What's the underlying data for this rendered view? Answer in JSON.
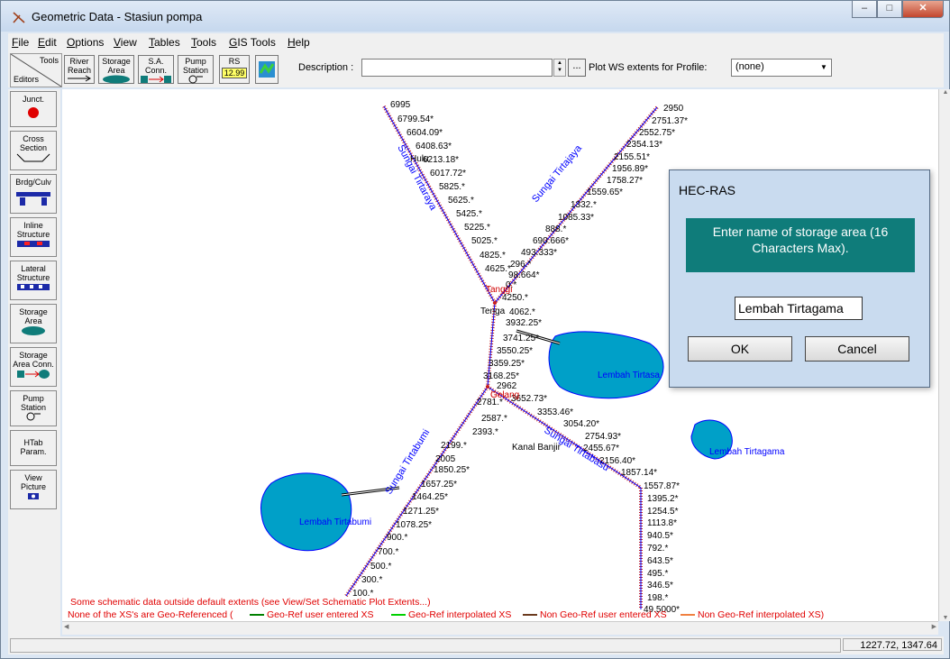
{
  "window": {
    "title": "Geometric Data - Stasiun pompa"
  },
  "menu": [
    {
      "u": "F",
      "rest": "ile"
    },
    {
      "u": "E",
      "rest": "dit"
    },
    {
      "u": "O",
      "rest": "ptions"
    },
    {
      "u": "V",
      "rest": "iew"
    },
    {
      "u": "T",
      "rest": "ables"
    },
    {
      "u": "T",
      "rest": "ools"
    },
    {
      "u": "G",
      "rest": "IS Tools"
    },
    {
      "u": "H",
      "rest": "elp"
    }
  ],
  "toolbar": {
    "corner_tools": "Tools",
    "corner_editors": "Editors",
    "river_reach": "River\nReach",
    "storage_area": "Storage\nArea",
    "sa_conn": "S.A.\nConn.",
    "pump_station": "Pump\nStation",
    "rs_label": "RS",
    "rs_value": "12.99",
    "description_label": "Description :",
    "description_value": "",
    "dots": "...",
    "plot_ws_label": "Plot WS extents for Profile:",
    "plot_ws_value": "(none)"
  },
  "editors": [
    {
      "name": "junct",
      "label": "Junct."
    },
    {
      "name": "cross-section",
      "label": "Cross\nSection"
    },
    {
      "name": "brdg-culv",
      "label": "Brdg/Culv"
    },
    {
      "name": "inline-structure",
      "label": "Inline\nStructure"
    },
    {
      "name": "lateral-structure",
      "label": "Lateral\nStructure"
    },
    {
      "name": "storage-area",
      "label": "Storage\nArea"
    },
    {
      "name": "storage-area-conn",
      "label": "Storage\nArea Conn."
    },
    {
      "name": "pump-station",
      "label": "Pump\nStation"
    },
    {
      "name": "htab-param",
      "label": "HTab\nParam."
    },
    {
      "name": "view-picture",
      "label": "View\nPicture"
    }
  ],
  "schematic": {
    "reach_left_stations": [
      "6995",
      "6799.54*",
      "6604.09*",
      "6408.63*",
      "6213.18*",
      "6017.72*",
      "5825.*",
      "5625.*",
      "5425.*",
      "5225.*",
      "5025.*",
      "4825.*",
      "4625.*"
    ],
    "reach_upper_right_stations": [
      "2950",
      "2751.37*",
      "2552.75*",
      "2354.13*",
      "2155.51*",
      "1956.89*",
      "1758.27*",
      "1559.65*",
      "1332.*",
      "1085.33*",
      "888.*",
      "690.666*",
      "493.333*",
      "296.*",
      "98.664*",
      "0.*"
    ],
    "reach_middle_stations": [
      "4250.*",
      "4062.*",
      "3932.25*",
      "3741.25*",
      "3550.25*",
      "3359.25*",
      "3168.25*",
      "2962"
    ],
    "reach_lower_stations": [
      "2781.*",
      "2587.*",
      "2393.*",
      "2199.*",
      "2005",
      "1850.25*",
      "1657.25*",
      "1464.25*",
      "1271.25*",
      "1078.25*",
      "900.*",
      "700.*",
      "500.*",
      "300.*",
      "100.*"
    ],
    "reach_right_stations": [
      "3652.73*",
      "3353.46*",
      "3054.20*",
      "2754.93*",
      "2455.67*",
      "2156.40*",
      "1857.14*",
      "1557.87*",
      "1395.2*",
      "1254.5*",
      "1113.8*",
      "940.5*",
      "792.*",
      "643.5*",
      "495.*",
      "346.5*",
      "198.*",
      "49.5000*"
    ],
    "river_labels": [
      "Sungai Tirtaraya",
      "Sungai Tirtajaya",
      "Sungai Tirtabumi",
      "Sungai Tirtabasu"
    ],
    "reach_labels": [
      "Hulu",
      "Tanggi",
      "Tenga",
      "Gelang",
      "Kanal Banjir"
    ],
    "storage_areas": [
      "Lembah Tirtasa",
      "Lembah Tirtagama",
      "Lembah Tirtabumi"
    ],
    "warning_1": "Some schematic data outside default extents (see View/Set Schematic Plot Extents...)",
    "warning_2_prefix": "None of the XS's are Geo-Referenced (",
    "legend": [
      "Geo-Ref user entered XS",
      "Geo-Ref interpolated XS",
      "Non Geo-Ref user entered XS",
      "Non Geo-Ref interpolated XS)"
    ],
    "colors": {
      "xs": "#c81e1e",
      "legend_green_dark": "#008000",
      "legend_green_light": "#00d000",
      "legend_brown": "#6b3a1e",
      "legend_orange": "#f08040",
      "storage": "#00a0c8",
      "river": "#0000ff"
    }
  },
  "status": {
    "coords": "1227.72, 1347.64"
  },
  "dialog": {
    "title": "HEC-RAS",
    "message": "Enter name of storage area (16 Characters Max).",
    "input_value": "Lembah Tirtagama",
    "ok": "OK",
    "cancel": "Cancel"
  }
}
